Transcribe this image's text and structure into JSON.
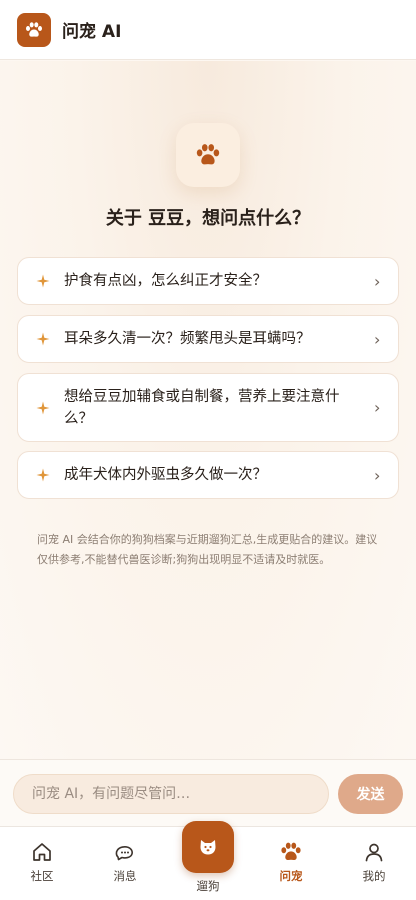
{
  "header": {
    "title": "问宠 AI"
  },
  "hero": {
    "title": "关于 豆豆，想问点什么？"
  },
  "suggestions": [
    {
      "text": "护食有点凶，怎么纠正才安全？"
    },
    {
      "text": "耳朵多久清一次？频繁甩头是耳螨吗？"
    },
    {
      "text": "想给豆豆加辅食或自制餐，营养上要注意什么？"
    },
    {
      "text": "成年犬体内外驱虫多久做一次？"
    }
  ],
  "disclaimer": "问宠 AI 会结合你的狗狗档案与近期遛狗汇总,生成更贴合的建议。建议仅供参考,不能替代兽医诊断;狗狗出现明显不适请及时就医。",
  "input": {
    "placeholder": "问宠 AI，有问题尽管问…",
    "send_label": "发送"
  },
  "tabbar": {
    "items": [
      {
        "label": "社区",
        "icon": "home-icon"
      },
      {
        "label": "消息",
        "icon": "chat-icon"
      },
      {
        "label": "遛狗",
        "icon": "dog-face-icon"
      },
      {
        "label": "问宠",
        "icon": "paw-icon",
        "active": true
      },
      {
        "label": "我的",
        "icon": "user-icon"
      }
    ]
  },
  "colors": {
    "accent": "#b8571a",
    "send_button": "#dfa98a",
    "spark": "#e0963a"
  }
}
